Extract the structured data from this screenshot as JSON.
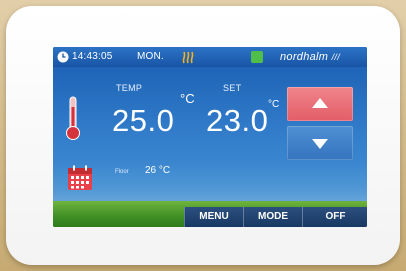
{
  "status_bar": {
    "time": "14:43:05",
    "day": "MON.",
    "brand": "nordhalm",
    "brand_mark": "///"
  },
  "readings": {
    "temp_label": "TEMP",
    "temp_value": "25.0",
    "temp_unit": "°C",
    "set_label": "SET",
    "set_value": "23.0",
    "set_unit": "°C",
    "floor_label": "Floor",
    "floor_value": "26 °C"
  },
  "controls": {
    "up_label": "increase",
    "down_label": "decrease",
    "menu": "MENU",
    "mode": "MODE",
    "off": "OFF"
  },
  "icons": {
    "clock": "clock-icon",
    "heating": "heating-icon",
    "brand": "brand-logo-icon",
    "thermometer": "thermometer-icon",
    "calendar": "calendar-icon"
  },
  "colors": {
    "screen_blue": "#1f64b6",
    "up_button": "#e35d67",
    "down_button": "#3574bf",
    "grass": "#4a9a2c"
  }
}
